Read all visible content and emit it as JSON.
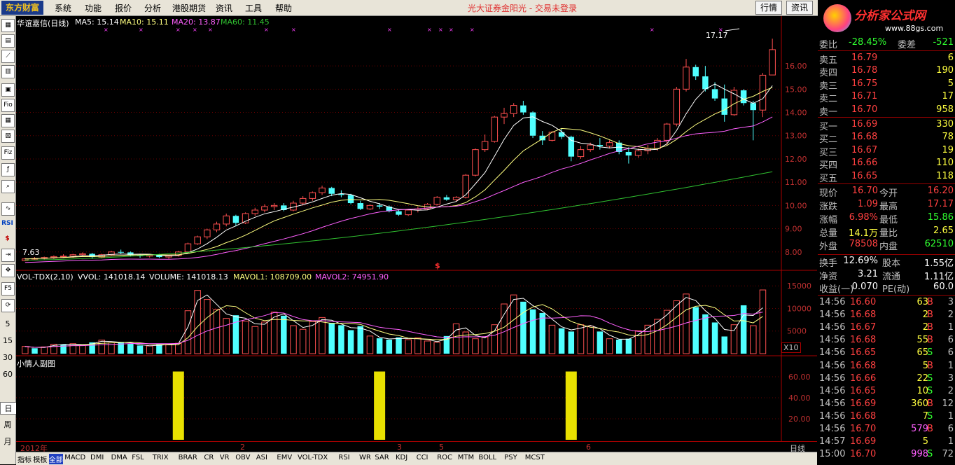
{
  "menubar": {
    "logo": "东方财富",
    "items": [
      "系统",
      "功能",
      "报价",
      "分析",
      "港股期货",
      "资讯",
      "工具",
      "帮助"
    ],
    "title": "光大证券金阳光 - 交易未登录",
    "btn_quote": "行情",
    "btn_info": "资讯",
    "brand": "分析家公式网",
    "brand_url": "www.88gs.com"
  },
  "lefttools": {
    "labels": [
      "Fio",
      "Fiz",
      "RSI",
      "F5"
    ],
    "numbers": [
      "5",
      "15",
      "30",
      "60",
      "日",
      "周",
      "月"
    ]
  },
  "main": {
    "name": "华谊嘉信(日线)",
    "ma5_label": "MA5: 15.14",
    "ma10_label": "MA10: 15.11",
    "ma20_label": "MA20: 13.87",
    "ma60_label": "MA60: 11.45",
    "peak_label": "17.17",
    "low_label": "7.63",
    "dollar_mark": "$",
    "colors": {
      "up": "#ff5050",
      "down": "#50ffff",
      "ma5": "#ffffff",
      "ma10": "#ffff80",
      "ma20": "#ff60ff",
      "ma60": "#30c030"
    }
  },
  "vol": {
    "indicator": "VOL-TDX(2,10)",
    "vvol": "VVOL: 141018.14",
    "volume": "VOLUME: 141018.13",
    "mavol1": "MAVOL1: 108709.00",
    "mavol2": "MAVOL2: 74951.90",
    "scale": "X10"
  },
  "sub": {
    "title": "小情人副图"
  },
  "timeaxis": {
    "labels": [
      "2012年",
      "2",
      "3",
      "5",
      "6"
    ],
    "period": "日线"
  },
  "tabs": [
    "指标",
    "模板",
    "全部",
    "MACD",
    "DMI",
    "DMA",
    "FSL",
    "TRIX",
    "BRAR",
    "CR",
    "VR",
    "OBV",
    "ASI",
    "EMV",
    "VOL-TDX",
    "RSI",
    "WR",
    "SAR",
    "KDJ",
    "CCI",
    "ROC",
    "MTM",
    "BOLL",
    "PSY",
    "MCST"
  ],
  "quote": {
    "ratio_label": "委比",
    "ratio_value": "-28.45%",
    "diff_label": "委差",
    "diff_value": "-521",
    "asks": [
      {
        "label": "卖五",
        "price": "16.79",
        "vol": "6"
      },
      {
        "label": "卖四",
        "price": "16.78",
        "vol": "190"
      },
      {
        "label": "卖三",
        "price": "16.75",
        "vol": "5"
      },
      {
        "label": "卖二",
        "price": "16.71",
        "vol": "17"
      },
      {
        "label": "卖一",
        "price": "16.70",
        "vol": "958"
      }
    ],
    "bids": [
      {
        "label": "买一",
        "price": "16.69",
        "vol": "330"
      },
      {
        "label": "买二",
        "price": "16.68",
        "vol": "78"
      },
      {
        "label": "买三",
        "price": "16.67",
        "vol": "19"
      },
      {
        "label": "买四",
        "price": "16.66",
        "vol": "110"
      },
      {
        "label": "买五",
        "price": "16.65",
        "vol": "118"
      }
    ],
    "stats": [
      {
        "l1": "现价",
        "v1": "16.70",
        "l2": "今开",
        "v2": "16.20"
      },
      {
        "l1": "涨跌",
        "v1": "1.09",
        "l2": "最高",
        "v2": "17.17"
      },
      {
        "l1": "涨幅",
        "v1": "6.98%",
        "l2": "最低",
        "v2": "15.86"
      },
      {
        "l1": "总量",
        "v1": "14.1万",
        "l2": "量比",
        "v2": "2.65"
      },
      {
        "l1": "外盘",
        "v1": "78508",
        "l2": "内盘",
        "v2": "62510"
      }
    ],
    "stats2": [
      {
        "l1": "换手",
        "v1": "12.69%",
        "l2": "股本",
        "v2": "1.55亿"
      },
      {
        "l1": "净资",
        "v1": "3.21",
        "l2": "流通",
        "v2": "1.11亿"
      },
      {
        "l1": "收益(一)",
        "v1": "0.070",
        "l2": "PE(动)",
        "v2": "60.0"
      }
    ],
    "ticks": [
      {
        "t": "14:56",
        "p": "16.60",
        "v": "63",
        "s": "B",
        "n": "3"
      },
      {
        "t": "14:56",
        "p": "16.68",
        "v": "2",
        "s": "B",
        "n": "2"
      },
      {
        "t": "14:56",
        "p": "16.67",
        "v": "2",
        "s": "B",
        "n": "1"
      },
      {
        "t": "14:56",
        "p": "16.68",
        "v": "55",
        "s": "B",
        "n": "6"
      },
      {
        "t": "14:56",
        "p": "16.65",
        "v": "65",
        "s": "S",
        "n": "6"
      },
      {
        "t": "14:56",
        "p": "16.68",
        "v": "5",
        "s": "B",
        "n": "1"
      },
      {
        "t": "14:56",
        "p": "16.66",
        "v": "22",
        "s": "S",
        "n": "3"
      },
      {
        "t": "14:56",
        "p": "16.65",
        "v": "10",
        "s": "S",
        "n": "2"
      },
      {
        "t": "14:56",
        "p": "16.69",
        "v": "360",
        "s": "B",
        "n": "12"
      },
      {
        "t": "14:56",
        "p": "16.68",
        "v": "7",
        "s": "S",
        "n": "1"
      },
      {
        "t": "14:56",
        "p": "16.70",
        "v": "579",
        "s": "B",
        "n": "6"
      },
      {
        "t": "14:57",
        "p": "16.69",
        "v": "5",
        "s": "",
        "n": "1"
      },
      {
        "t": "15:00",
        "p": "16.70",
        "v": "998",
        "s": "S",
        "n": "72"
      }
    ]
  },
  "chart_data": [
    {
      "type": "candlestick",
      "title": "华谊嘉信(日线)",
      "ylim": [
        7.3,
        17.6
      ],
      "yticks": [
        8,
        9,
        10,
        11,
        12,
        13,
        14,
        15,
        16
      ],
      "ohlc": [
        [
          7.63,
          7.75,
          7.6,
          7.7
        ],
        [
          7.7,
          7.78,
          7.65,
          7.72
        ],
        [
          7.72,
          7.8,
          7.68,
          7.76
        ],
        [
          7.76,
          7.85,
          7.7,
          7.8
        ],
        [
          7.8,
          7.9,
          7.74,
          7.82
        ],
        [
          7.82,
          7.92,
          7.75,
          7.88
        ],
        [
          7.88,
          7.98,
          7.82,
          7.92
        ],
        [
          7.92,
          7.96,
          7.7,
          7.78
        ],
        [
          7.78,
          7.92,
          7.72,
          7.88
        ],
        [
          7.88,
          8.05,
          7.85,
          8.0
        ],
        [
          8.0,
          8.1,
          7.92,
          7.98
        ],
        [
          7.98,
          8.02,
          7.8,
          7.85
        ],
        [
          7.85,
          7.92,
          7.75,
          7.82
        ],
        [
          7.82,
          7.9,
          7.76,
          7.86
        ],
        [
          7.86,
          7.92,
          7.74,
          7.78
        ],
        [
          7.78,
          7.88,
          7.7,
          7.84
        ],
        [
          7.84,
          8.05,
          7.8,
          8.0
        ],
        [
          8.0,
          8.4,
          7.95,
          8.35
        ],
        [
          8.35,
          8.7,
          8.3,
          8.65
        ],
        [
          8.65,
          9.0,
          8.55,
          8.95
        ],
        [
          8.95,
          9.3,
          8.85,
          9.2
        ],
        [
          9.2,
          9.65,
          9.1,
          9.55
        ],
        [
          9.55,
          9.6,
          9.1,
          9.25
        ],
        [
          9.25,
          9.7,
          9.2,
          9.65
        ],
        [
          9.65,
          9.9,
          9.55,
          9.8
        ],
        [
          9.8,
          10.05,
          9.7,
          9.95
        ],
        [
          9.95,
          10.1,
          9.8,
          10.0
        ],
        [
          10.0,
          10.1,
          9.75,
          9.8
        ],
        [
          9.8,
          10.2,
          9.75,
          10.1
        ],
        [
          10.1,
          10.4,
          10.0,
          10.3
        ],
        [
          10.3,
          10.6,
          10.2,
          10.55
        ],
        [
          10.55,
          10.85,
          10.45,
          10.75
        ],
        [
          10.75,
          10.8,
          10.4,
          10.5
        ],
        [
          10.5,
          10.65,
          10.35,
          10.45
        ],
        [
          10.45,
          10.5,
          10.05,
          10.1
        ],
        [
          10.1,
          10.2,
          9.8,
          9.85
        ],
        [
          9.85,
          10.05,
          9.8,
          10.0
        ],
        [
          10.0,
          10.1,
          9.85,
          9.95
        ],
        [
          9.95,
          10.0,
          9.7,
          9.75
        ],
        [
          9.75,
          9.8,
          9.55,
          9.6
        ],
        [
          9.6,
          9.85,
          9.55,
          9.8
        ],
        [
          9.8,
          9.95,
          9.7,
          9.85
        ],
        [
          9.85,
          10.1,
          9.8,
          10.05
        ],
        [
          10.05,
          10.4,
          10.0,
          10.35
        ],
        [
          10.35,
          10.45,
          10.2,
          10.25
        ],
        [
          10.25,
          10.4,
          10.15,
          10.35
        ],
        [
          10.35,
          11.35,
          10.3,
          11.3
        ],
        [
          11.3,
          12.45,
          11.25,
          12.4
        ],
        [
          12.4,
          13.05,
          12.3,
          12.75
        ],
        [
          12.75,
          13.85,
          12.7,
          13.8
        ],
        [
          13.8,
          14.2,
          13.5,
          13.95
        ],
        [
          13.95,
          14.4,
          13.8,
          14.3
        ],
        [
          14.3,
          14.5,
          13.9,
          14.0
        ],
        [
          14.0,
          14.05,
          12.9,
          13.0
        ],
        [
          13.0,
          13.2,
          12.6,
          12.8
        ],
        [
          12.8,
          13.2,
          12.75,
          13.15
        ],
        [
          13.15,
          13.3,
          12.85,
          12.95
        ],
        [
          12.95,
          13.0,
          11.9,
          12.1
        ],
        [
          12.1,
          12.55,
          12.0,
          12.4
        ],
        [
          12.4,
          12.7,
          12.3,
          12.6
        ],
        [
          12.6,
          12.9,
          12.4,
          12.55
        ],
        [
          12.55,
          12.8,
          12.45,
          12.7
        ],
        [
          12.7,
          12.8,
          12.2,
          12.3
        ],
        [
          12.3,
          12.5,
          11.8,
          12.15
        ],
        [
          12.15,
          12.45,
          12.05,
          12.35
        ],
        [
          12.35,
          12.6,
          12.2,
          12.45
        ],
        [
          12.45,
          12.9,
          12.35,
          12.8
        ],
        [
          12.8,
          13.55,
          12.6,
          13.5
        ],
        [
          13.5,
          15.1,
          13.4,
          15.0
        ],
        [
          15.0,
          16.3,
          14.9,
          15.95
        ],
        [
          15.95,
          16.05,
          15.4,
          15.55
        ],
        [
          15.55,
          16.0,
          14.9,
          15.0
        ],
        [
          15.0,
          15.3,
          14.5,
          14.6
        ],
        [
          14.6,
          15.2,
          13.6,
          13.9
        ],
        [
          13.9,
          15.1,
          13.85,
          14.95
        ],
        [
          14.95,
          15.0,
          14.3,
          14.4
        ],
        [
          14.4,
          14.5,
          12.8,
          14.1
        ],
        [
          14.1,
          15.7,
          13.8,
          15.6
        ],
        [
          15.61,
          17.17,
          15.86,
          16.7
        ]
      ],
      "ma_lines": {
        "MA5": 15.14,
        "MA10": 15.11,
        "MA20": 13.87,
        "MA60": 11.45
      }
    },
    {
      "type": "bar",
      "title": "VOL-TDX(2,10)",
      "ylim": [
        0,
        15500
      ],
      "yticks": [
        5000,
        10000,
        15000
      ],
      "values": [
        1600,
        1200,
        1500,
        2100,
        2000,
        2200,
        1800,
        2500,
        3000,
        2400,
        2600,
        2200,
        1800,
        1700,
        2000,
        2100,
        2300,
        9500,
        14000,
        12000,
        9800,
        7800,
        8500,
        7200,
        6000,
        7000,
        9200,
        8400,
        6200,
        5400,
        7100,
        8000,
        6800,
        6300,
        5200,
        6100,
        3900,
        3400,
        3100,
        3600,
        3100,
        3500,
        2800,
        2500,
        3900,
        6600,
        4800,
        3300,
        3700,
        6400,
        11000,
        13000,
        11500,
        9800,
        9000,
        6300,
        5600,
        4900,
        6400,
        6100,
        4900,
        3300,
        3100,
        3300,
        5100,
        6300,
        7600,
        9600,
        11700,
        13200,
        10300,
        8700,
        6900,
        3800,
        6400,
        10700,
        6200,
        14100
      ],
      "up_flags": [
        1,
        0,
        1,
        1,
        0,
        1,
        1,
        0,
        1,
        1,
        0,
        0,
        0,
        1,
        0,
        1,
        1,
        1,
        1,
        1,
        1,
        1,
        0,
        1,
        1,
        1,
        1,
        0,
        1,
        1,
        1,
        1,
        0,
        0,
        0,
        0,
        1,
        0,
        0,
        0,
        1,
        1,
        1,
        1,
        0,
        1,
        1,
        1,
        1,
        1,
        1,
        1,
        0,
        0,
        0,
        1,
        0,
        0,
        1,
        1,
        0,
        1,
        0,
        0,
        1,
        1,
        1,
        1,
        1,
        1,
        0,
        0,
        0,
        0,
        1,
        0,
        1,
        1
      ]
    },
    {
      "type": "bar",
      "title": "小情人副图",
      "ylim": [
        0,
        70
      ],
      "yticks": [
        20,
        40,
        60
      ],
      "signal_bars": [
        16,
        37,
        57
      ]
    }
  ]
}
